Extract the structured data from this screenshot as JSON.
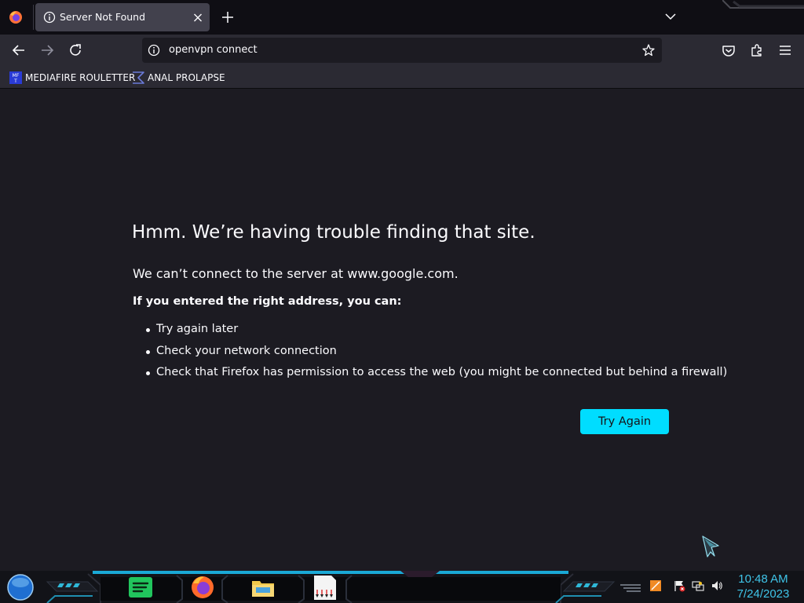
{
  "browser": {
    "tab": {
      "title": "Server Not Found"
    },
    "url": "openvpn connect",
    "bookmarks": [
      {
        "label": "MEDIAFIRE ROULETTER",
        "icon": "mediafire-icon",
        "icon_text": "MF\nT"
      },
      {
        "label": "ANAL PROLAPSE",
        "icon": "sigma-icon"
      }
    ]
  },
  "error_page": {
    "title": "Hmm. We’re having trouble finding that site.",
    "description": "We can’t connect to the server at www.google.com.",
    "subheading": "If you entered the right address, you can:",
    "suggestions": [
      "Try again later",
      "Check your network connection",
      "Check that Firefox has permission to access the web (you might be connected but behind a firewall)"
    ],
    "button_label": "Try Again"
  },
  "taskbar": {
    "apps": [
      "spotify-icon",
      "firefox-icon",
      "file-explorer-icon",
      "document-icon"
    ],
    "tray": [
      "network-status-icon",
      "flag-icon",
      "network-icon",
      "volume-icon"
    ],
    "time": "10:48 AM",
    "date": "7/24/2023"
  },
  "colors": {
    "accent": "#00ddff",
    "page_bg": "#1c1b22",
    "toolbar_bg": "#2b2a33",
    "clock": "#3fc4e8"
  }
}
